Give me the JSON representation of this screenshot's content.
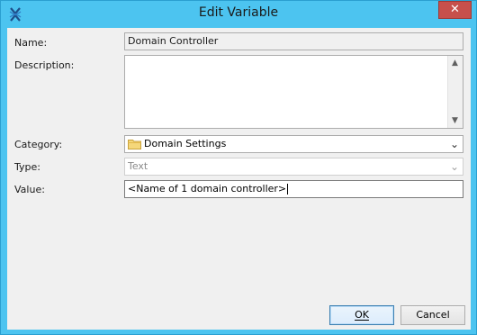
{
  "window": {
    "title": "Edit Variable",
    "close_glyph": "✕",
    "accent": "#4cc4f0"
  },
  "form": {
    "name_label": "Name:",
    "name_value": "Domain Controller",
    "description_label": "Description:",
    "description_value": "",
    "category_label": "Category:",
    "category_value": "Domain Settings",
    "type_label": "Type:",
    "type_value": "Text",
    "value_label": "Value:",
    "value_value": "<Name of 1 domain controller>"
  },
  "buttons": {
    "ok_label": "OK",
    "cancel_label": "Cancel"
  },
  "icons": {
    "app": "app-logo-icon",
    "folder": "folder-icon",
    "close": "close-icon"
  }
}
